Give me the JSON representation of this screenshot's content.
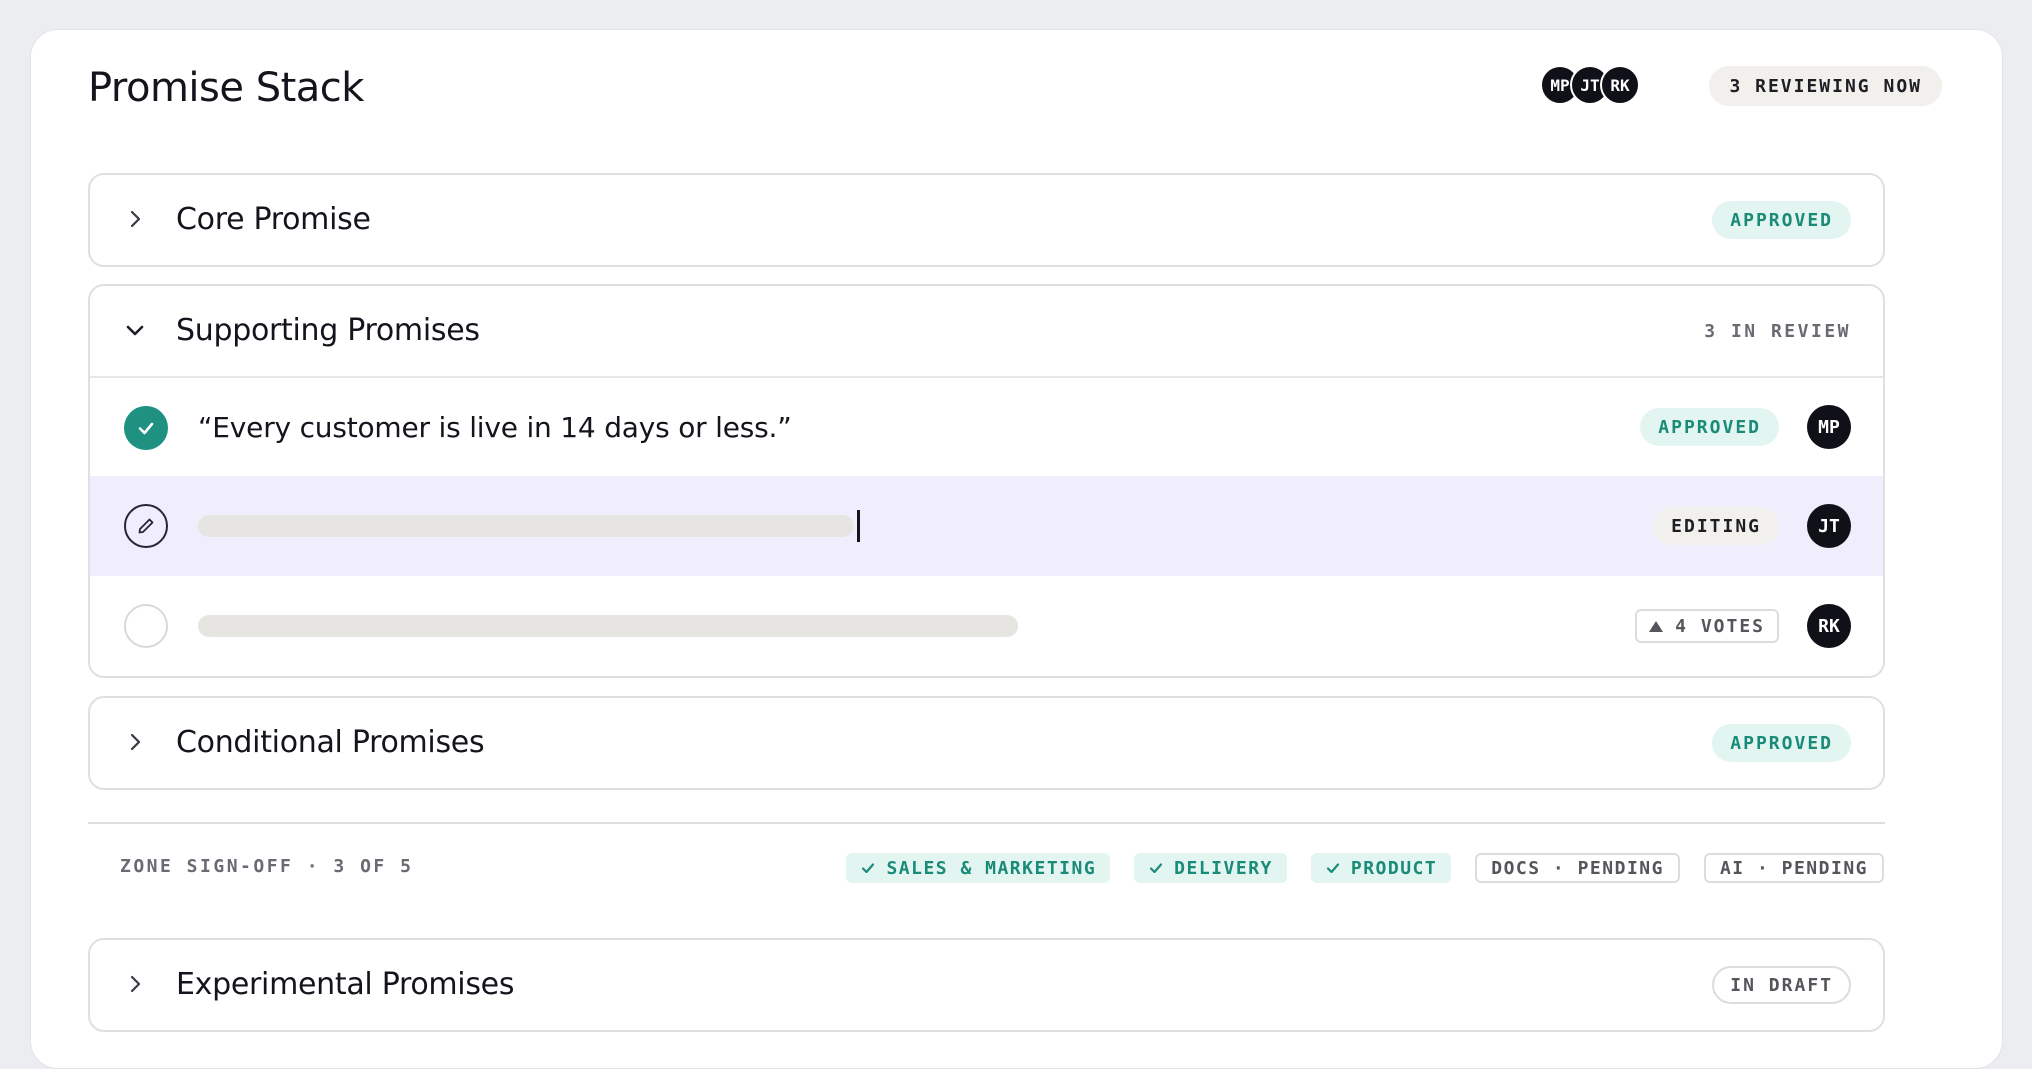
{
  "page": {
    "title": "Promise Stack"
  },
  "presence": {
    "avatars": [
      "MP",
      "JT",
      "RK"
    ],
    "status": "3 REVIEWING NOW"
  },
  "sections": {
    "core": {
      "title": "Core Promise",
      "status": "APPROVED",
      "expanded": false
    },
    "supporting": {
      "title": "Supporting Promises",
      "meta": "3 IN REVIEW",
      "expanded": true,
      "items": [
        {
          "text": "“Every customer is live in 14 days or less.”",
          "status": "APPROVED",
          "owner": "MP",
          "state": "done"
        },
        {
          "text": "",
          "status": "EDITING",
          "owner": "JT",
          "state": "editing"
        },
        {
          "text": "",
          "votes": "4 VOTES",
          "owner": "RK",
          "state": "open"
        }
      ]
    },
    "conditional": {
      "title": "Conditional Promises",
      "status": "APPROVED",
      "expanded": false
    },
    "experimental": {
      "title": "Experimental Promises",
      "status": "IN DRAFT",
      "expanded": false
    }
  },
  "signoff": {
    "label": "ZONE SIGN-OFF · 3 OF 5",
    "zones": [
      {
        "label": "SALES & MARKETING",
        "done": true
      },
      {
        "label": "DELIVERY",
        "done": true
      },
      {
        "label": "PRODUCT",
        "done": true
      },
      {
        "label": "DOCS · PENDING",
        "done": false
      },
      {
        "label": "AI · PENDING",
        "done": false
      }
    ]
  },
  "colors": {
    "accent_teal": "#1e9181",
    "approved_bg": "#e2f5f1",
    "editing_row_bg": "#f0eefd",
    "avatar_bg": "#0f1018",
    "page_bg": "#ebedf0"
  },
  "icons": {
    "collapsed": "chevron-right-icon",
    "expanded": "chevron-down-icon",
    "done": "check-icon",
    "editing": "pencil-icon",
    "votes": "triangle-up-icon"
  }
}
